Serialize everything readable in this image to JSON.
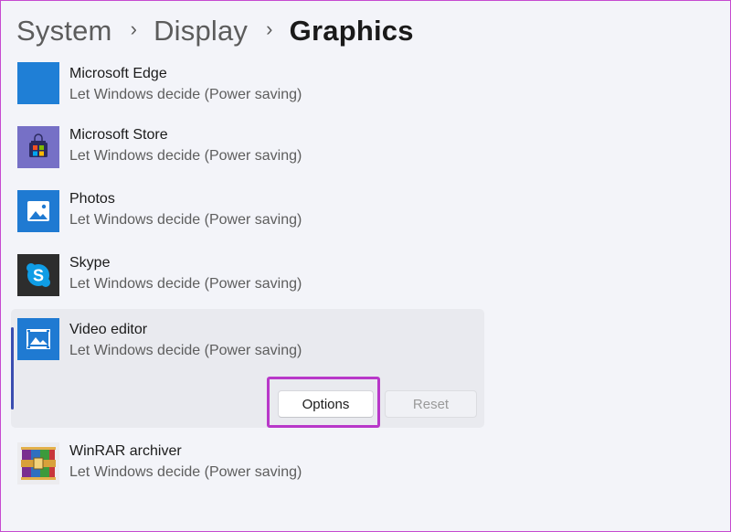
{
  "breadcrumb": {
    "items": [
      "System",
      "Display"
    ],
    "current": "Graphics",
    "separator": "›"
  },
  "apps": [
    {
      "name": "Microsoft Edge",
      "status": "Let Windows decide (Power saving)",
      "icon": "microsoft-edge-icon"
    },
    {
      "name": "Microsoft Store",
      "status": "Let Windows decide (Power saving)",
      "icon": "microsoft-store-icon"
    },
    {
      "name": "Photos",
      "status": "Let Windows decide (Power saving)",
      "icon": "photos-icon"
    },
    {
      "name": "Skype",
      "status": "Let Windows decide (Power saving)",
      "icon": "skype-icon"
    },
    {
      "name": "Video editor",
      "status": "Let Windows decide (Power saving)",
      "icon": "video-editor-icon",
      "expanded": true
    },
    {
      "name": "WinRAR archiver",
      "status": "Let Windows decide (Power saving)",
      "icon": "winrar-icon"
    }
  ],
  "buttons": {
    "options": "Options",
    "reset": "Reset"
  },
  "colors": {
    "background": "#f3f4f9",
    "accent": "#3a4db0",
    "highlight": "#b838c9"
  }
}
